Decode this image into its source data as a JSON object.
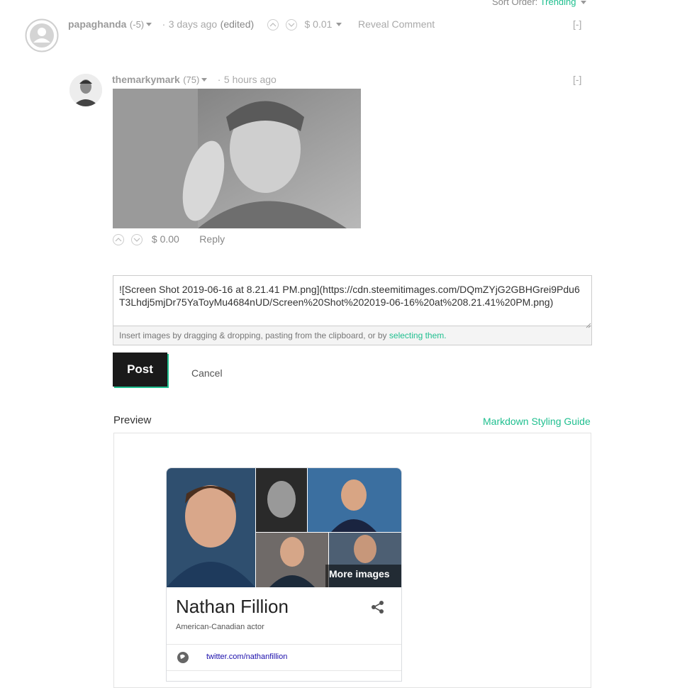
{
  "sort": {
    "label": "Sort Order:",
    "value": "Trending"
  },
  "comment1": {
    "author": "papaghanda",
    "reputation": "(-5)",
    "time": "3 days ago",
    "edited": "(edited)",
    "payout": "$ 0.01",
    "reveal": "Reveal Comment",
    "collapse": "[-]"
  },
  "comment2": {
    "author": "themarkymark",
    "reputation": "(75)",
    "time": "5 hours ago",
    "collapse": "[-]",
    "payout": "$ 0.00",
    "reply": "Reply"
  },
  "editor": {
    "text": "![Screen Shot 2019-06-16 at 8.21.41 PM.png](https://cdn.steemitimages.com/DQmZYjG2GBHGrei9Pdu6T3Lhdj5mjDr75YaToyMu4684nUD/Screen%20Shot%202019-06-16%20at%208.21.41%20PM.png)",
    "hint": "Insert images by dragging & dropping, pasting from the clipboard, or by",
    "hint_link": "selecting them."
  },
  "actions": {
    "post": "Post",
    "cancel": "Cancel"
  },
  "preview": {
    "label": "Preview",
    "guide": "Markdown Styling Guide"
  },
  "knowledge_card": {
    "more_images": "More images",
    "name": "Nathan Fillion",
    "description": "American-Canadian actor",
    "link": "twitter.com/nathanfillion"
  },
  "colors": {
    "accent": "#1fbf8f",
    "dark": "#1a1a1a"
  }
}
